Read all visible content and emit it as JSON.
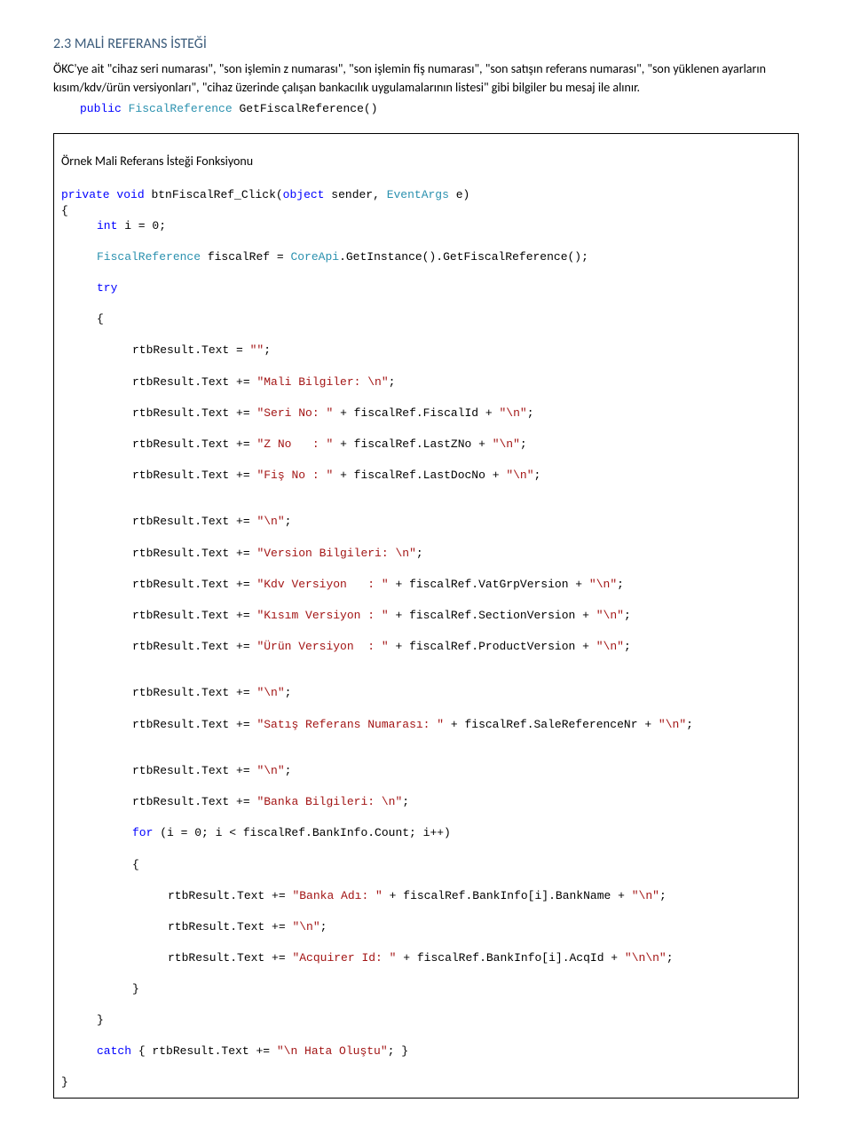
{
  "heading": "2.3   MALİ REFERANS İSTEĞİ",
  "para1": "ÖKC'ye ait \"cihaz seri numarası\", \"son işlemin z numarası\", \"son işlemin fiş numarası\", \"son satışın referans numarası\", \"son yüklenen ayarların kısım/kdv/ürün versiyonları\", \"cihaz üzerinde çalışan bankacılık uygulamalarının listesi\" gibi bilgiler bu mesaj ile alınır.",
  "sig": {
    "kw1": "public",
    "type": "FiscalReference",
    "name": " GetFiscalReference()"
  },
  "box": {
    "title": "Örnek Mali Referans İsteği Fonksiyonu",
    "l1a": "private",
    "l1b": "void",
    "l1c": " btnFiscalRef_Click(",
    "l1d": "object",
    "l1e": " sender, ",
    "l1f": "EventArgs",
    "l1g": " e)",
    "l2": "{",
    "l3a": "int",
    "l3b": " i = 0;",
    "l4a": "FiscalReference",
    "l4b": " fiscalRef = ",
    "l4c": "CoreApi",
    "l4d": ".GetInstance().GetFiscalReference();",
    "l5": "try",
    "l6": "{",
    "l7a": "rtbResult.Text = ",
    "l7b": "\"\"",
    "l7c": ";",
    "l8a": "rtbResult.Text += ",
    "l8b": "\"Mali Bilgiler: \\n\"",
    "l8c": ";",
    "l9a": "rtbResult.Text += ",
    "l9b": "\"Seri No: \"",
    "l9c": " + fiscalRef.FiscalId + ",
    "l9d": "\"\\n\"",
    "l9e": ";",
    "l10a": "rtbResult.Text += ",
    "l10b": "\"Z No   : \"",
    "l10c": " + fiscalRef.LastZNo + ",
    "l10d": "\"\\n\"",
    "l10e": ";",
    "l11a": "rtbResult.Text += ",
    "l11b": "\"Fiş No : \"",
    "l11c": " + fiscalRef.LastDocNo + ",
    "l11d": "\"\\n\"",
    "l11e": ";",
    "l12a": "rtbResult.Text += ",
    "l12b": "\"\\n\"",
    "l12c": ";",
    "l13a": "rtbResult.Text += ",
    "l13b": "\"Version Bilgileri: \\n\"",
    "l13c": ";",
    "l14a": "rtbResult.Text += ",
    "l14b": "\"Kdv Versiyon   : \"",
    "l14c": " + fiscalRef.VatGrpVersion + ",
    "l14d": "\"\\n\"",
    "l14e": ";",
    "l15a": "rtbResult.Text += ",
    "l15b": "\"Kısım Versiyon : \"",
    "l15c": " + fiscalRef.SectionVersion + ",
    "l15d": "\"\\n\"",
    "l15e": ";",
    "l16a": "rtbResult.Text += ",
    "l16b": "\"Ürün Versiyon  : \"",
    "l16c": " + fiscalRef.ProductVersion + ",
    "l16d": "\"\\n\"",
    "l16e": ";",
    "l17a": "rtbResult.Text += ",
    "l17b": "\"\\n\"",
    "l17c": ";",
    "l18a": "rtbResult.Text += ",
    "l18b": "\"Satış Referans Numarası: \"",
    "l18c": " + fiscalRef.SaleReferenceNr + ",
    "l18d": "\"\\n\"",
    "l18e": ";",
    "l19a": "rtbResult.Text += ",
    "l19b": "\"\\n\"",
    "l19c": ";",
    "l20a": "rtbResult.Text += ",
    "l20b": "\"Banka Bilgileri: \\n\"",
    "l20c": ";",
    "l21a": "for",
    "l21b": " (i = 0; i < fiscalRef.BankInfo.Count; i++)",
    "l22": "{",
    "l23a": "rtbResult.Text += ",
    "l23b": "\"Banka Adı: \"",
    "l23c": " + fiscalRef.BankInfo[i].BankName + ",
    "l23d": "\"\\n\"",
    "l23e": ";",
    "l24a": "rtbResult.Text += ",
    "l24b": "\"\\n\"",
    "l24c": ";",
    "l25a": "rtbResult.Text += ",
    "l25b": "\"Acquirer Id: \"",
    "l25c": " + fiscalRef.BankInfo[i].AcqId + ",
    "l25d": "\"\\n\\n\"",
    "l25e": ";",
    "l26": "}",
    "l27": "}",
    "l28a": "catch",
    "l28b": " { rtbResult.Text += ",
    "l28c": "\"\\n Hata Oluştu\"",
    "l28d": "; }",
    "l29": "}"
  }
}
